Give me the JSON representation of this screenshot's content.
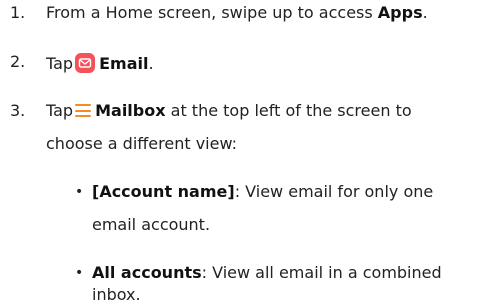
{
  "steps": [
    {
      "number": "1.",
      "text_before": "From a Home screen, swipe up to access ",
      "bold": "Apps",
      "text_after": "."
    },
    {
      "number": "2.",
      "text_before": "Tap",
      "icon": "email-app-icon",
      "bold": "Email",
      "text_after": "."
    },
    {
      "number": "3.",
      "text_before": "Tap",
      "icon": "menu-icon",
      "bold": "Mailbox",
      "text_after": " at the top left of the screen to",
      "line2": "choose a different view:",
      "bullets": [
        {
          "bold": "[Account name]",
          "text": ": View email for only one",
          "line2": "email account."
        },
        {
          "bold": "All accounts",
          "text": ": View all email in a combined",
          "line2": "inbox."
        }
      ]
    }
  ],
  "colors": {
    "email_icon": "#f4525a",
    "menu_icon": "#f28c28"
  }
}
